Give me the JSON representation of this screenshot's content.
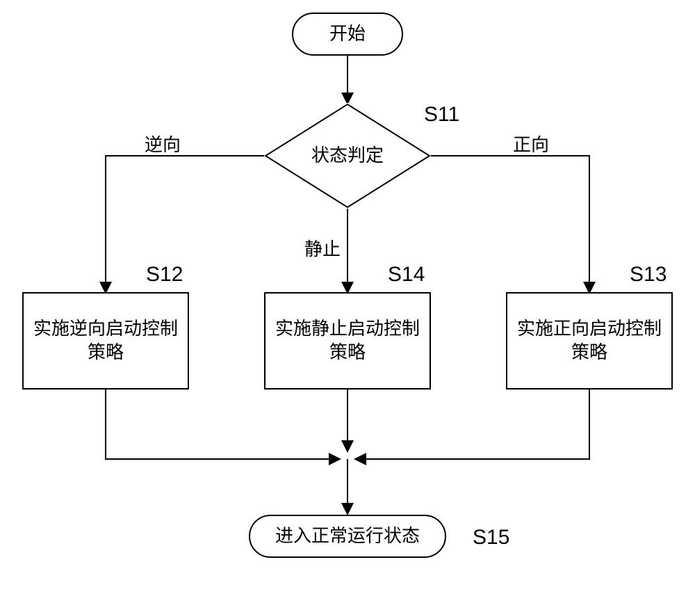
{
  "nodes": {
    "start": "开始",
    "decision": "状态判定",
    "s12": "实施逆向启动控制策略",
    "s14": "实施静止启动控制策略",
    "s13": "实施正向启动控制策略",
    "end": "进入正常运行状态"
  },
  "edges": {
    "reverse": "逆向",
    "still": "静止",
    "forward": "正向"
  },
  "steps": {
    "s11": "S11",
    "s12": "S12",
    "s13": "S13",
    "s14": "S14",
    "s15": "S15"
  }
}
